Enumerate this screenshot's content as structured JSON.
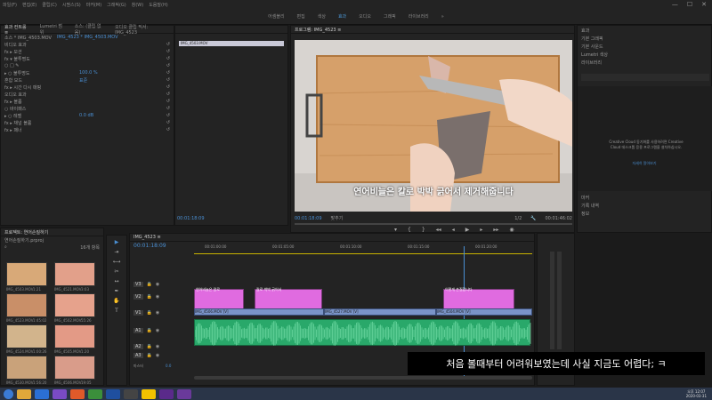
{
  "menu": {
    "items": [
      "파일(F)",
      "편집(E)",
      "클립(C)",
      "시퀀스(S)",
      "마커(M)",
      "그래픽(G)",
      "창(W)",
      "도움말(H)"
    ]
  },
  "workspaces": {
    "tabs": [
      "어셈블리",
      "편집",
      "색상",
      "효과",
      "오디오",
      "그래픽",
      "라이브러리"
    ],
    "active_index": 3
  },
  "effect_controls": {
    "tabs": [
      "효과 컨트롤 ≡",
      "Lumetri 범위",
      "소스: (클립 없음)",
      "오디오 클립 믹서: IMG_4523"
    ],
    "source": "소스 * IMG_4503.MOV",
    "clip": "IMG_4523 * IMG_4503.MOV",
    "rows": [
      {
        "label": "비디오 효과",
        "value": ""
      },
      {
        "label": "fx ▸ 모션",
        "value": ""
      },
      {
        "label": "fx ▾ 불투명도",
        "value": ""
      },
      {
        "label": "○ □ ✎",
        "value": ""
      },
      {
        "label": "▸ ○ 불투명도",
        "value": "100.0 %"
      },
      {
        "label": "혼합 모드",
        "value": "표준"
      },
      {
        "label": "fx ▸ 시간 다시 매핑",
        "value": ""
      },
      {
        "label": "오디오 효과",
        "value": ""
      },
      {
        "label": "fx ▸ 볼륨",
        "value": ""
      },
      {
        "label": "○ 바이패스",
        "value": ""
      },
      {
        "label": "▸ ○ 레벨",
        "value": "0.0 dB"
      },
      {
        "label": "fx ▸ 채널 볼륨",
        "value": ""
      },
      {
        "label": "fx ▸ 패너",
        "value": ""
      }
    ],
    "mini_clip": "IMG_4503.MOV",
    "timecode": "00:01:18:09"
  },
  "program": {
    "title": "프로그램: IMG_4523 ≡",
    "subtitle_text": "연어비늘은 칼로 박박 긁어서 제거해줍니다",
    "timecode": "00:01:18:09",
    "fit": "맞추기",
    "quality": "1/2",
    "duration": "00:01:46:02"
  },
  "project": {
    "title": "프로젝트: 연어손질하기",
    "subtitle": "연어손질하기.prproj",
    "count": "16개 항목",
    "items": [
      {
        "name": "IMG_4503.MOV",
        "dur": "1:21"
      },
      {
        "name": "IMG_4521.MOV",
        "dur": "3:03"
      },
      {
        "name": "IMG_4523.MOV",
        "dur": "1:45:02"
      },
      {
        "name": "IMG_4502.MOV",
        "dur": "55:26"
      },
      {
        "name": "IMG_4524.MOV",
        "dur": "1:00:26"
      },
      {
        "name": "IMG_4505.MOV",
        "dur": "1:20"
      },
      {
        "name": "IMG_4530.MOV",
        "dur": "1:56:20"
      },
      {
        "name": "IMG_4506.MOV",
        "dur": "19:05"
      }
    ]
  },
  "timeline": {
    "tab": "IMG_4523 ≡",
    "timecode": "00:01:18:09",
    "ruler": [
      "00:01:00:00",
      "00:01:05:00",
      "00:01:10:00",
      "00:01:15:00",
      "00:01:20:00"
    ],
    "tracks": [
      "V3",
      "V2",
      "V1",
      "A1",
      "A2",
      "A3",
      "마스터"
    ],
    "master_value": "0.0",
    "clips_v1": [
      "IMG_4506.MOV [V]",
      "IMG_4527.MOV [V]",
      "IMG_4504.MOV [V]"
    ],
    "subtitle_clips": [
      "연어비늘은 칼로",
      "칼로 박박 긁어서",
      "이렇게 손질합니다"
    ]
  },
  "right_panel": {
    "tabs": [
      "효과",
      "기본 그래픽",
      "기본 사운드",
      "Lumetri 색상",
      "라이브러리"
    ],
    "message": "Creative Cloud 동기화를 사용하려면 Creative Cloud 데스크톱 응용 프로그램을 설치하십시오.",
    "link": "자세히 알아보기",
    "bottom": [
      "마커",
      "기록 내역",
      "정보"
    ]
  },
  "caption": "처음 볼때부터 어려워보였는데 사실 지금도 어렵다; ㅋ",
  "taskbar": {
    "time": "오후 12:07",
    "date": "2020-03-31"
  }
}
